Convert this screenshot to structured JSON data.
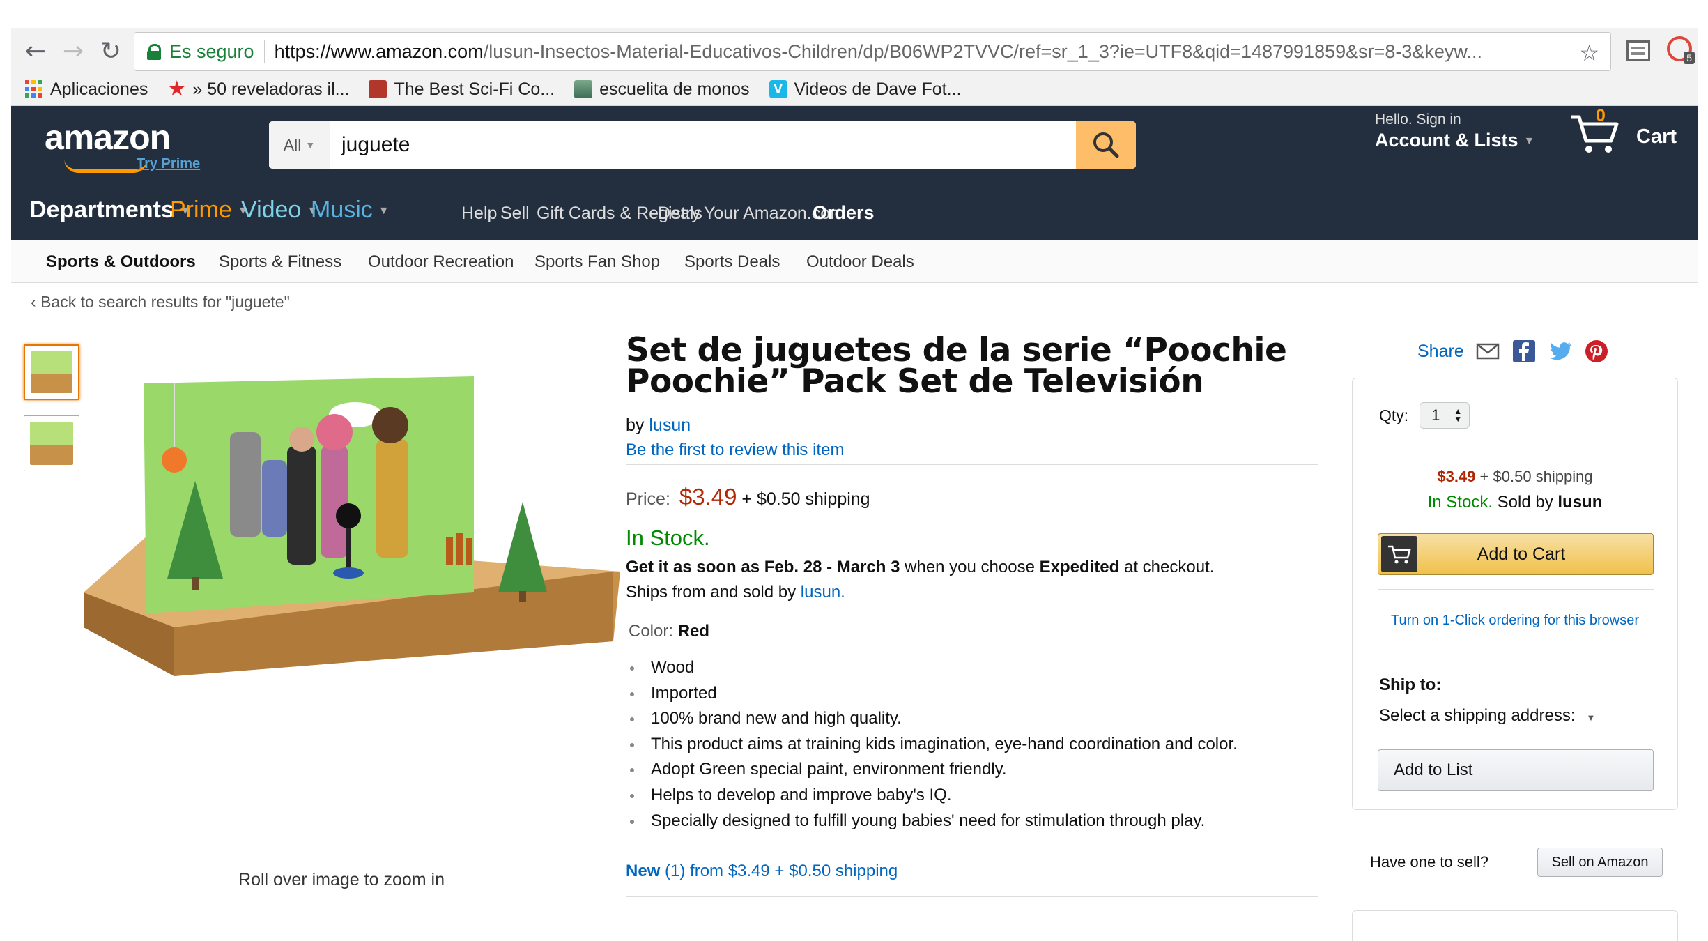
{
  "browser": {
    "secure_label": "Es seguro",
    "url_host": "https://www.amazon.com",
    "url_path": "/lusun-Insectos-Material-Educativos-Children/dp/B06WP2TVVC/ref=sr_1_3?ie=UTF8&qid=1487991859&sr=8-3&keyw...",
    "extension_badge": "5",
    "bookmarks": [
      {
        "icon": "apps-icon",
        "label": "Aplicaciones"
      },
      {
        "icon": "star-icon",
        "label": "» 50 reveladoras il..."
      },
      {
        "icon": "film-icon",
        "label": "The Best Sci-Fi Co..."
      },
      {
        "icon": "monkey-icon",
        "label": "escuelita de monos"
      },
      {
        "icon": "vimeo-icon",
        "label": "Videos de Dave Fot..."
      }
    ]
  },
  "header": {
    "logo_text": "amazon",
    "try_prime": "Try Prime",
    "search_category": "All",
    "search_value": "juguete",
    "nav": {
      "departments": "Departments",
      "prime": "Prime",
      "video": "Video",
      "music": "Music",
      "help": "Help",
      "sell": "Sell",
      "gift_cards": "Gift Cards & Registry",
      "deals": "Deals",
      "your_amazon": "Your Amazon.com",
      "orders": "Orders"
    },
    "account_hello": "Hello. Sign in",
    "account_label": "Account & Lists",
    "cart_count": "0",
    "cart_label": "Cart"
  },
  "subnav": [
    "Sports & Outdoors",
    "Sports & Fitness",
    "Outdoor Recreation",
    "Sports Fan Shop",
    "Sports Deals",
    "Outdoor Deals"
  ],
  "back_link": "Back to search results for \"juguete\"",
  "gallery": {
    "zoom_hint": "Roll over image to zoom in"
  },
  "product": {
    "title": "Set de juguetes de la serie “Poochie Poochie” Pack Set de Televisión",
    "by": "by",
    "brand": "lusun",
    "review_link": "Be the first to review this item",
    "price_label": "Price:",
    "price": "$3.49",
    "shipping": "+ $0.50 shipping",
    "stock": "In Stock.",
    "delivery_prefix": "Get it as soon as Feb. 28 - March 3",
    "delivery_mid": " when you choose ",
    "delivery_method": "Expedited",
    "delivery_suffix": " at checkout.",
    "ships_from_prefix": "Ships from and sold by ",
    "ships_from_seller": "lusun.",
    "color_label": "Color:",
    "color_value": "Red",
    "bullets": [
      "Wood",
      "Imported",
      "100% brand new and high quality.",
      "This product aims at training kids imagination, eye-hand coordination and color.",
      "Adopt Green special paint, environment friendly.",
      "Helps to develop and improve baby's IQ.",
      "Specially designed to fulfill young babies' need for stimulation through play."
    ],
    "new_offer_prefix": "New",
    "new_offer_suffix": " (1) from $3.49 + $0.50 shipping"
  },
  "buybox": {
    "share_label": "Share",
    "qty_label": "Qty:",
    "qty_value": "1",
    "price": "$3.49",
    "shipping": " + $0.50 shipping",
    "stock": "In Stock.",
    "sold_by_prefix": " Sold by ",
    "sold_by": "lusun",
    "add_to_cart": "Add to Cart",
    "one_click": "Turn on 1-Click ordering for this browser",
    "ship_to": "Ship to:",
    "ship_address": "Select a shipping address:",
    "add_to_list": "Add to List",
    "have_one": "Have one to sell?",
    "sell_button": "Sell on Amazon"
  },
  "colors": {
    "header_bg": "#232f3e",
    "accent_orange": "#ff9900",
    "price_red": "#b12704",
    "stock_green": "#008a00",
    "link_blue": "#0066c0"
  }
}
